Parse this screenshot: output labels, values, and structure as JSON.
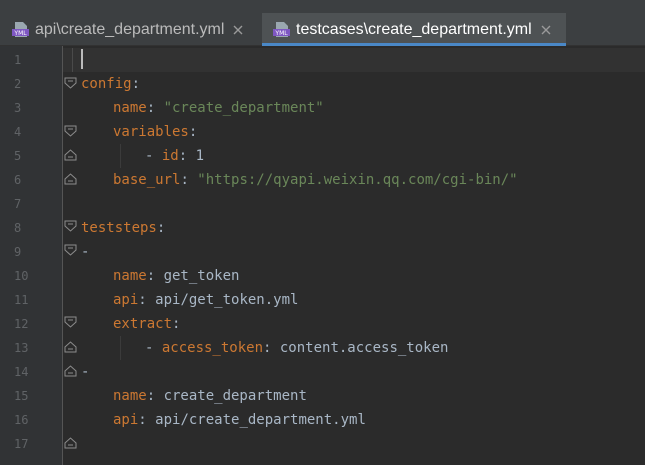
{
  "tabs": [
    {
      "label": "api\\create_department.yml",
      "icon": "yml-file-icon",
      "active": false
    },
    {
      "label": "testcases\\create_department.yml",
      "icon": "yml-file-icon",
      "active": true
    }
  ],
  "icon_text": "YML",
  "line_numbers": [
    "1",
    "2",
    "3",
    "4",
    "5",
    "6",
    "7",
    "8",
    "9",
    "10",
    "11",
    "12",
    "13",
    "14",
    "15",
    "16",
    "17"
  ],
  "code": {
    "l2_key": "config",
    "l2_colon": ":",
    "l3_key": "name",
    "l3_colon": ": ",
    "l3_val": "\"create_department\"",
    "l4_key": "variables",
    "l4_colon": ":",
    "l5_dash": "- ",
    "l5_key": "id",
    "l5_colon": ": ",
    "l5_val": "1",
    "l6_key": "base_url",
    "l6_colon": ": ",
    "l6_val": "\"https://qyapi.weixin.qq.com/cgi-bin/\"",
    "l8_key": "teststeps",
    "l8_colon": ":",
    "l9_dash": "-",
    "l10_key": "name",
    "l10_colon": ": ",
    "l10_val": "get_token",
    "l11_key": "api",
    "l11_colon": ": ",
    "l11_val": "api/get_token.yml",
    "l12_key": "extract",
    "l12_colon": ":",
    "l13_dash": "- ",
    "l13_key": "access_token",
    "l13_colon": ": ",
    "l13_val": "content.access_token",
    "l14_dash": "-",
    "l15_key": "name",
    "l15_colon": ": ",
    "l15_val": "create_department",
    "l16_key": "api",
    "l16_colon": ": ",
    "l16_val": "api/create_department.yml"
  },
  "colors": {
    "background": "#2b2b2b",
    "gutter": "#313335",
    "key": "#cc7832",
    "string": "#6a8759",
    "text": "#a9b7c6",
    "number": "#6897bb",
    "active_tab_underline": "#4a88c7"
  }
}
